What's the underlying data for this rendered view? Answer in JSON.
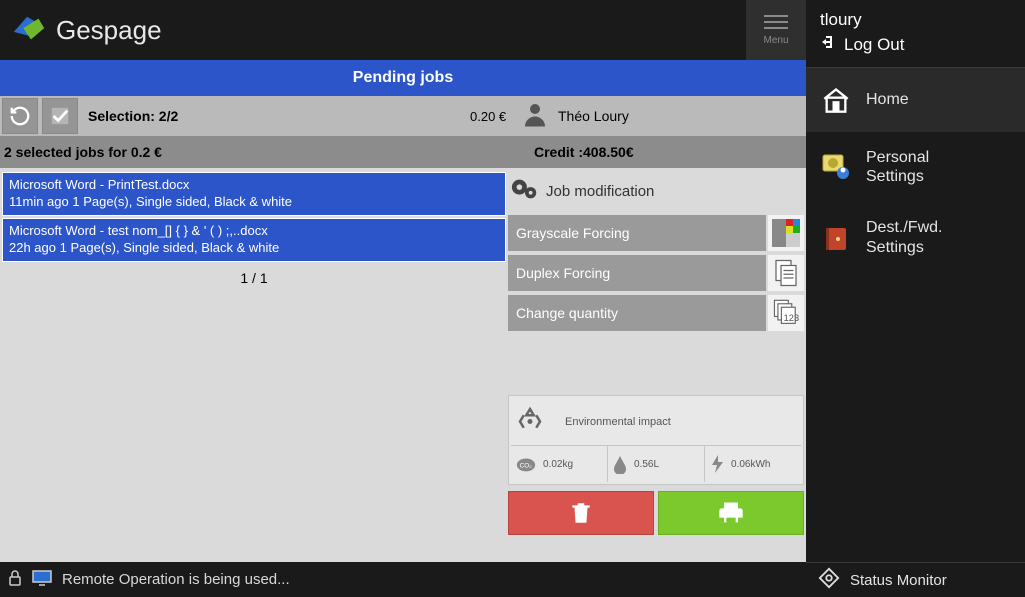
{
  "app": {
    "name": "Gespage",
    "menu_label": "Menu",
    "page_title": "Pending jobs"
  },
  "toolbar": {
    "selection_label": "Selection: 2/2",
    "cost": "0.20 €",
    "user_name": "Théo Loury"
  },
  "summary": {
    "left": "2 selected jobs for 0.2 €",
    "right": "Credit :408.50€"
  },
  "jobs": [
    {
      "title": "Microsoft Word - PrintTest.docx",
      "meta": "11min ago  1 Page(s), Single sided, Black & white"
    },
    {
      "title": "Microsoft Word - test nom_[] { } &   ' ( ) ;,..docx",
      "meta": "22h ago  1 Page(s), Single sided, Black & white"
    }
  ],
  "pagination": "1 / 1",
  "jobmod": {
    "header": "Job modification",
    "grayscale": "Grayscale Forcing",
    "duplex": "Duplex Forcing",
    "quantity": "Change quantity"
  },
  "env": {
    "header": "Environmental impact",
    "co2": "0.02kg",
    "water": "0.56L",
    "energy": "0.06kWh"
  },
  "status_bar": {
    "text": "Remote Operation is being used..."
  },
  "sidebar": {
    "username": "tloury",
    "logout": "Log Out",
    "home": "Home",
    "personal_line1": "Personal",
    "personal_line2": "Settings",
    "dest_line1": "Dest./Fwd.",
    "dest_line2": "Settings",
    "status_monitor": "Status Monitor"
  }
}
